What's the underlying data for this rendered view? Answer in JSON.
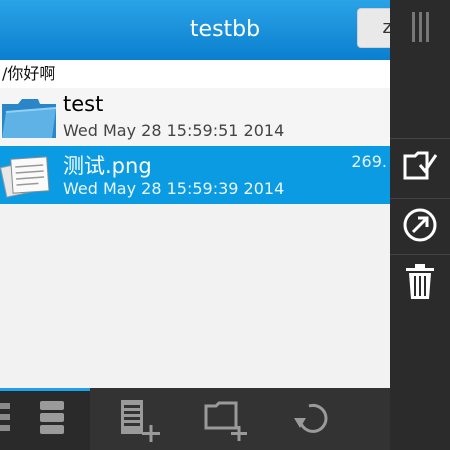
{
  "header": {
    "title": "testbb",
    "action_partial": "z"
  },
  "path": "/你好啊",
  "files": [
    {
      "name": "test",
      "date": "Wed May 28 15:59:51 2014",
      "size": "",
      "icon": "folder-icon",
      "selected": false
    },
    {
      "name": "测试.png",
      "date": "Wed May 28 15:59:39 2014",
      "size": "269.",
      "icon": "document-icon",
      "selected": true
    }
  ],
  "right_actions": [
    {
      "icon": "folder-check-icon"
    },
    {
      "icon": "share-arrow-icon"
    },
    {
      "icon": "trash-icon"
    }
  ],
  "bottom_actions": [
    {
      "icon": "list-view-icon",
      "active": true
    },
    {
      "icon": "add-file-icon"
    },
    {
      "icon": "add-folder-icon"
    },
    {
      "icon": "refresh-icon"
    }
  ],
  "colors": {
    "accent": "#0a9be3",
    "header_top": "#2aa3e6",
    "header_bottom": "#0b7fcf",
    "dark_bar": "#2b2b2b"
  }
}
